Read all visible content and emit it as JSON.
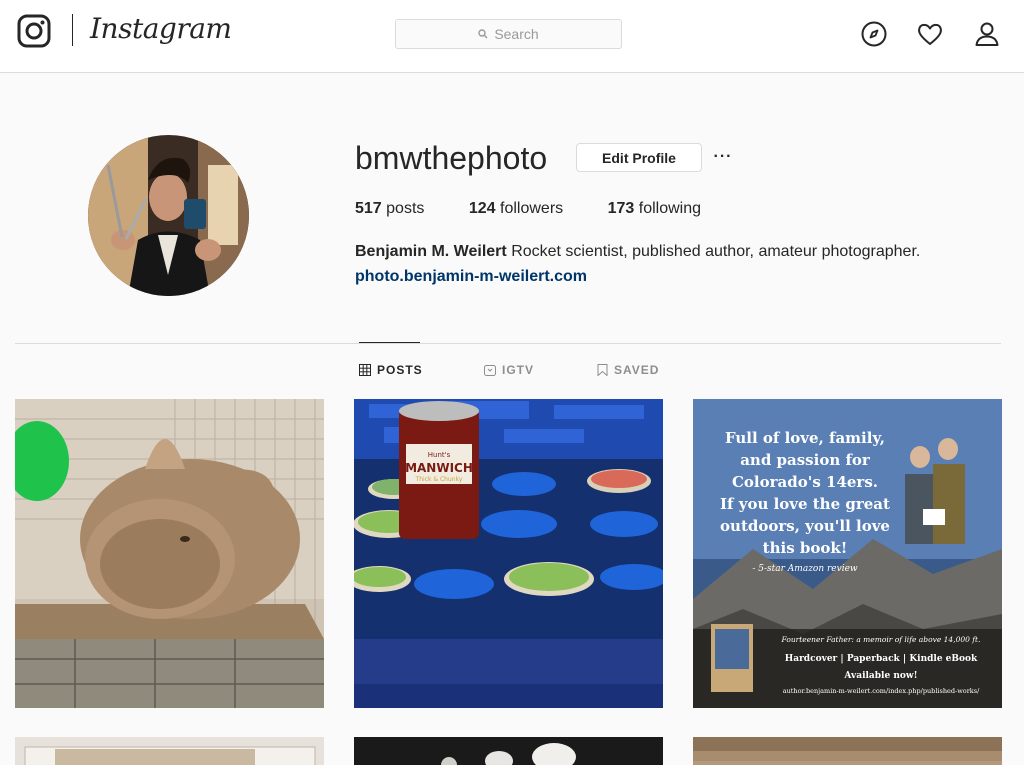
{
  "nav": {
    "brand": "Instagram",
    "search_placeholder": "Search",
    "icons": [
      "instagram-glyph-icon",
      "compass-icon",
      "heart-icon",
      "user-icon"
    ]
  },
  "profile": {
    "username": "bmwthephoto",
    "edit_label": "Edit Profile",
    "more_label": "···",
    "posts_count": "517",
    "posts_label": "posts",
    "followers_count": "124",
    "followers_label": "followers",
    "following_count": "173",
    "following_label": "following",
    "full_name": "Benjamin M. Weilert",
    "bio": "Rocket scientist, published author, amateur photographer.",
    "website": "photo.benjamin-m-weilert.com"
  },
  "tabs": [
    {
      "label": "POSTS",
      "active": true,
      "icon": "grid-icon"
    },
    {
      "label": "IGTV",
      "active": false,
      "icon": "igtv-icon"
    },
    {
      "label": "SAVED",
      "active": false,
      "icon": "bookmark-icon"
    }
  ],
  "posts": [
    {
      "subject": "rabbit"
    },
    {
      "subject": "canned food",
      "can_label_top": "Hunt's",
      "can_label_main": "MANWICH",
      "can_label_sub": "Thick & Chunky"
    },
    {
      "subject": "book ad",
      "headline": [
        "Full of love, family,",
        "and passion for",
        "Colorado's 14ers.",
        "If you love the great",
        "outdoors, you'll love",
        "this book!"
      ],
      "review": "- 5-star Amazon review",
      "book_title": "Fourteener Father: a memoir of life above 14,000 ft.",
      "formats": "Hardcover | Paperback | Kindle eBook",
      "availability": "Available now!",
      "url": "author.benjamin-m-weilert.com/index.php/published-works/"
    }
  ],
  "colors": {
    "link": "#003569",
    "border": "#dbdbdb",
    "text": "#262626",
    "muted": "#8e8e8e"
  }
}
